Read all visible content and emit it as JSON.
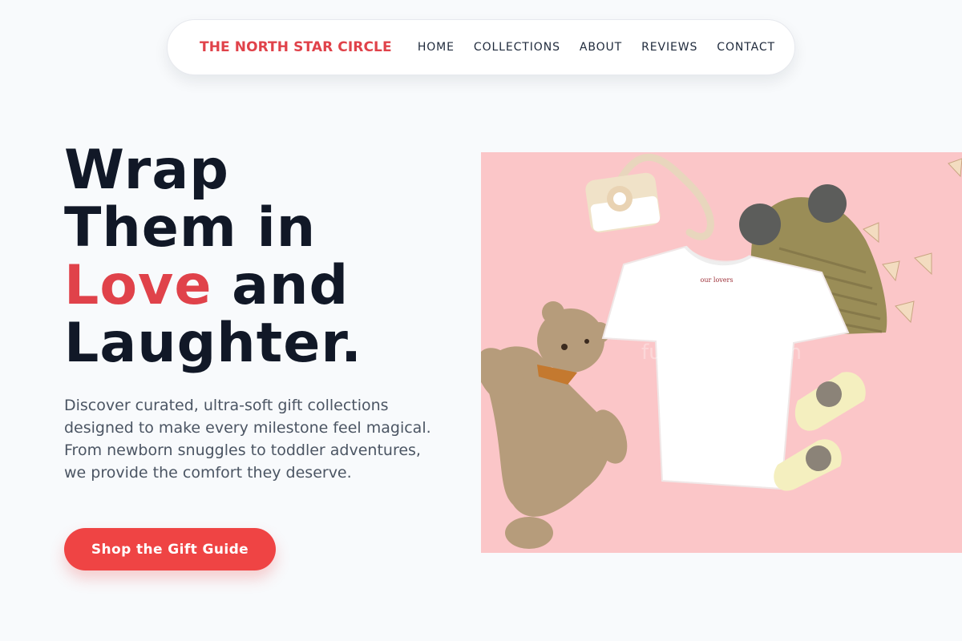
{
  "nav": {
    "brand": "THE NORTH STAR CIRCLE",
    "links": [
      "HOME",
      "COLLECTIONS",
      "ABOUT",
      "REVIEWS",
      "CONTACT"
    ]
  },
  "hero": {
    "headline_line1": "Wrap",
    "headline_line2": "Them in",
    "headline_accent": "Love",
    "headline_line3_rest": " and",
    "headline_line4": "Laughter.",
    "description": "Discover curated, ultra-soft gift collections designed to make every milestone feel magical. From newborn snuggles to toddler adventures, we provide the comfort they deserve.",
    "cta_label": "Shop the Gift Guide"
  },
  "image": {
    "subject": "baby gift flat lay with teddy bear, white t-shirt, knit pom-pom hat, wooden toy camera, bear socks and bunting flags on pink background",
    "shirt_label": "our lovers",
    "watermark": "furrymenu.com"
  },
  "colors": {
    "accent": "#e0424a",
    "cta": "#ef4444",
    "heading": "#111827",
    "body_text": "#4b5563",
    "page_bg": "#f8fafc",
    "image_bg": "#fbc6c8"
  }
}
